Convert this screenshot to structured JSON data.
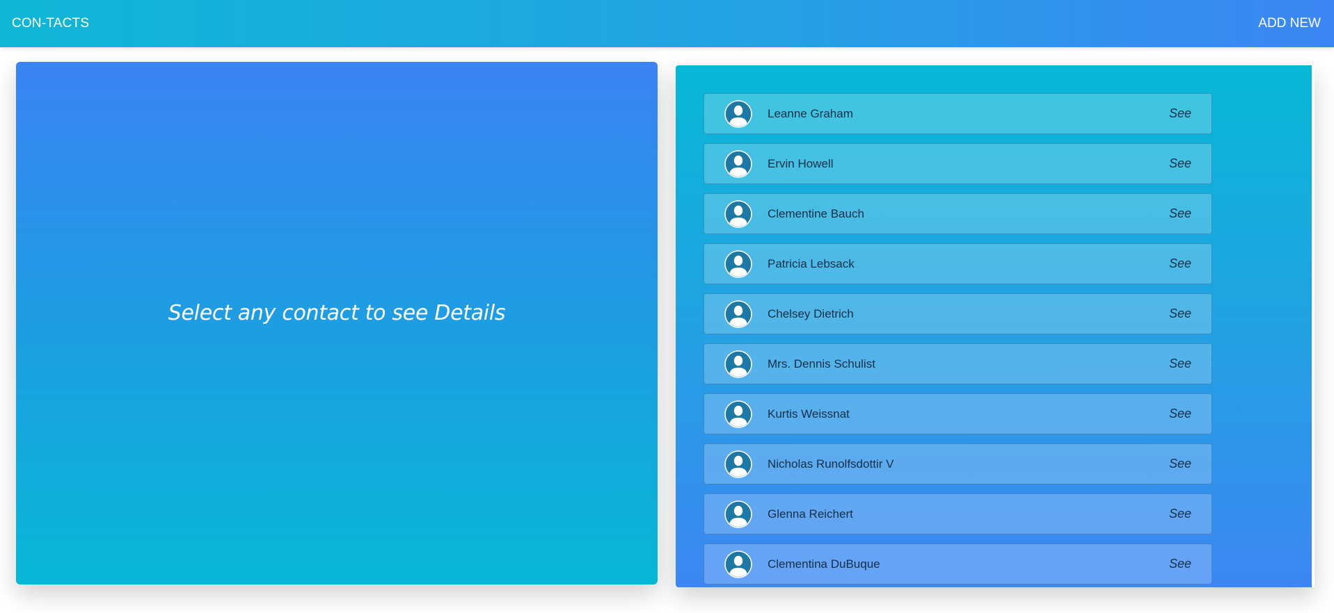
{
  "app": {
    "brand": "CON-TACTS",
    "add_new_label": "ADD NEW"
  },
  "details": {
    "placeholder": "Select any contact to see Details"
  },
  "contacts": {
    "see_label": "See",
    "avatar_icon": "user-avatar-icon",
    "items": [
      {
        "name": "Leanne Graham"
      },
      {
        "name": "Ervin Howell"
      },
      {
        "name": "Clementine Bauch"
      },
      {
        "name": "Patricia Lebsack"
      },
      {
        "name": "Chelsey Dietrich"
      },
      {
        "name": "Mrs. Dennis Schulist"
      },
      {
        "name": "Kurtis Weissnat"
      },
      {
        "name": "Nicholas Runolfsdottir V"
      },
      {
        "name": "Glenna Reichert"
      },
      {
        "name": "Clementina DuBuque"
      }
    ]
  },
  "colors": {
    "header_start": "#0fb6d6",
    "header_end": "#3c86f4",
    "panel_blue": "#3b84f4",
    "panel_cyan": "#07b7d5",
    "avatar_fill": "#1d78a6"
  }
}
